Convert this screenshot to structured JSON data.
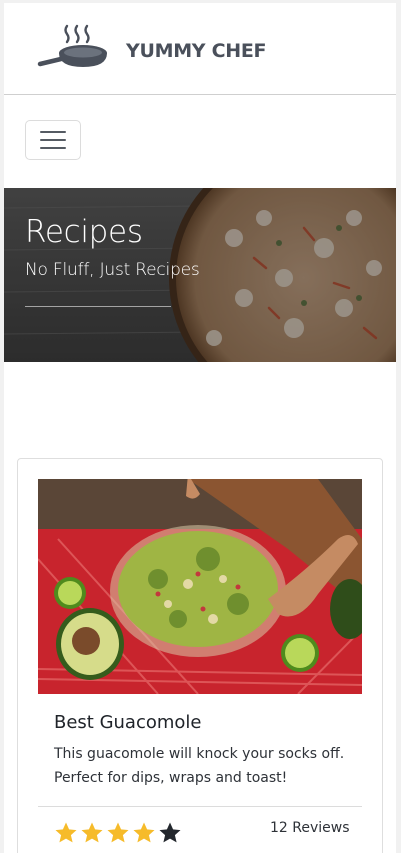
{
  "brand": {
    "name": "YUMMY CHEF",
    "logo_icon": "frying-pan-steam-icon",
    "text_color": "#4a505b"
  },
  "nav": {
    "menu_icon": "hamburger-menu-icon"
  },
  "hero": {
    "title": "Recipes",
    "subtitle": "No Fluff, Just Recipes",
    "background": "pizza-on-wooden-table-photo"
  },
  "recipe_card": {
    "image": "guacamole-bowl-photo",
    "title": "Best Guacomole",
    "description": "This guacomole will knock your socks off. Perfect for dips, wraps and toast!",
    "rating": 4,
    "rating_max": 5,
    "star_color_filled": "#f6bb2a",
    "star_color_empty": "#23272d",
    "reviews_label": "12 Reviews"
  }
}
